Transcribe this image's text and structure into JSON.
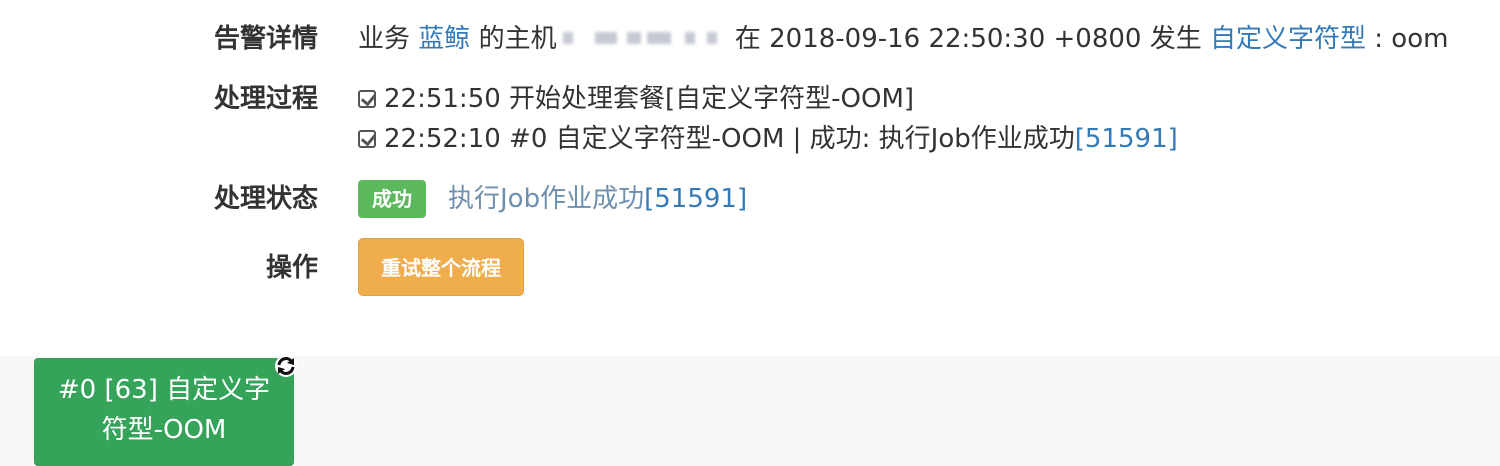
{
  "alert_details": {
    "label": "告警详情",
    "prefix": "业务",
    "business_name": "蓝鲸",
    "host_prefix": "的主机",
    "occurred_text": "在 2018-09-16 22:50:30 +0800 发生",
    "alert_type": "自定义字符型",
    "suffix": ": oom"
  },
  "process": {
    "label": "处理过程",
    "steps": [
      {
        "text": "22:51:50 开始处理套餐[自定义字符型-OOM]",
        "link": ""
      },
      {
        "text": "22:52:10 #0 自定义字符型-OOM | 成功: 执行Job作业成功",
        "link": "[51591]"
      }
    ]
  },
  "status": {
    "label": "处理状态",
    "badge": "成功",
    "message": "执行Job作业成功",
    "message_link": "[51591]",
    "badge_color": "#5cb85c"
  },
  "operation": {
    "label": "操作",
    "retry_button": "重试整个流程",
    "button_color": "#f0ad4e"
  },
  "flow": {
    "node_line1": "#0 [63] 自定义字",
    "node_line2": "符型-OOM",
    "node_color": "#36a35a",
    "node_icon": "refresh-icon"
  }
}
